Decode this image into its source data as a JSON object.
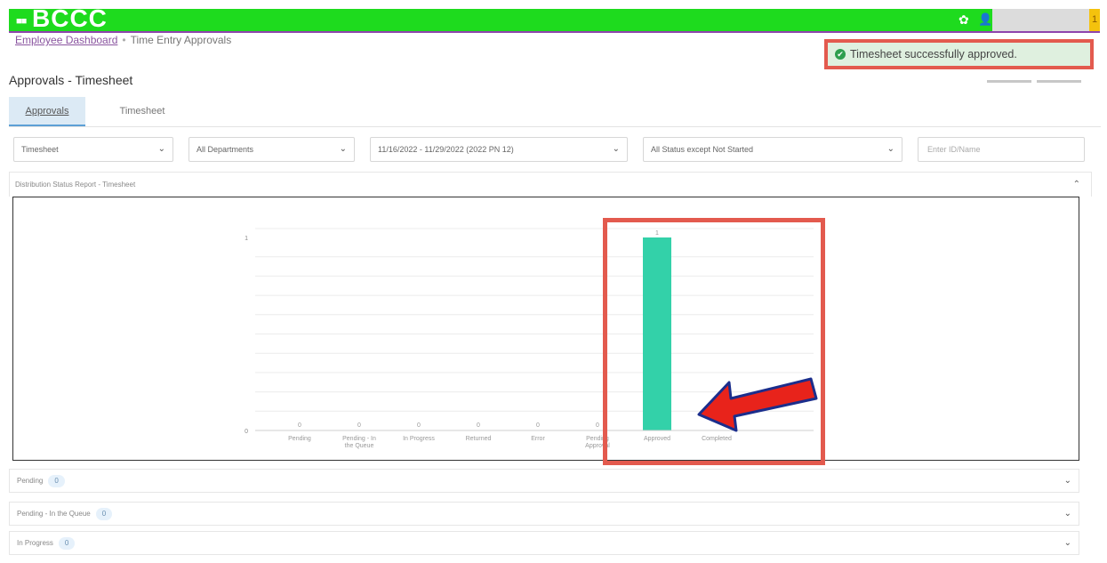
{
  "header": {
    "brand": "BCCC",
    "notification_count": "1",
    "colors": {
      "bar": "#1edb1e",
      "accent_line": "#8e44ad",
      "badge": "#f4c20d"
    },
    "icons": [
      "grid-icon",
      "gear-icon",
      "user-icon"
    ]
  },
  "breadcrumb": {
    "home": "Employee Dashboard",
    "current": "Time Entry Approvals"
  },
  "toast": {
    "message": "Timesheet successfully approved.",
    "icon": "check-circle-icon",
    "color": "#2e9e4e"
  },
  "page": {
    "title": "Approvals - Timesheet"
  },
  "tabs": [
    {
      "label": "Approvals",
      "active": true
    },
    {
      "label": "Timesheet",
      "active": false
    }
  ],
  "filters": {
    "type": "Timesheet",
    "department": "All Departments",
    "period": "11/16/2022 - 11/29/2022 (2022 PN 12)",
    "status": "All Status except Not Started",
    "id_placeholder": "Enter ID/Name"
  },
  "report": {
    "title": "Distribution Status Report - Timesheet"
  },
  "chart_data": {
    "type": "bar",
    "categories": [
      "Pending",
      "Pending - In the Queue",
      "In Progress",
      "Returned",
      "Error",
      "Pending Approval",
      "Approved",
      "Completed"
    ],
    "values": [
      0,
      0,
      0,
      0,
      0,
      0,
      1,
      null
    ],
    "yticks": [
      "0",
      "1"
    ],
    "ylim": [
      0,
      1
    ],
    "bar_color": "#33d1a9",
    "grid": true
  },
  "accordion": [
    {
      "label": "Pending",
      "count": "0"
    },
    {
      "label": "Pending - In the Queue",
      "count": "0"
    },
    {
      "label": "In Progress",
      "count": "0"
    }
  ],
  "annotation_color": "#e35a4e"
}
